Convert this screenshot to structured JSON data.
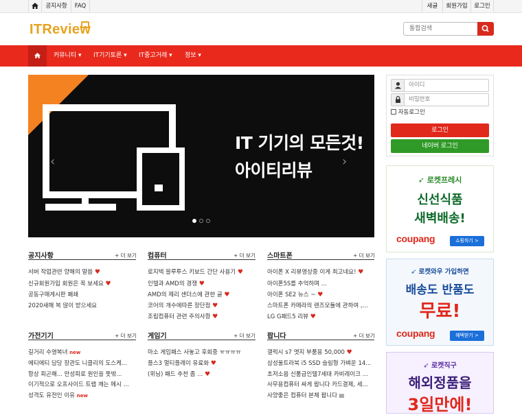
{
  "topbar": {
    "left": [
      "공지사항",
      "FAQ"
    ],
    "right": [
      "새글",
      "회원가입",
      "로그인"
    ]
  },
  "header": {
    "logo_text": "ITReview",
    "search_placeholder": "통합검색"
  },
  "nav": {
    "items": [
      "커뮤니티 ▾",
      "IT기기토론 ▾",
      "IT중고거래 ▾",
      "정보 ▾"
    ]
  },
  "slider": {
    "line1": "IT 기기의 모든것!",
    "line2": "아이티리뷰",
    "slide_count": 3,
    "active_slide": 1
  },
  "login": {
    "id_placeholder": "아이디",
    "pw_placeholder": "비밀번호",
    "remember_label": "자동로그인",
    "login_button": "로그인",
    "naver_button": "네이버 로그인"
  },
  "ads": [
    {
      "top": "로켓프레시",
      "line1": "신선식품",
      "line2": "새벽배송!",
      "brand": "coupang",
      "button": "쇼핑하기 >"
    },
    {
      "top": "로켓와우 가입하면",
      "line1": "배송도 반품도",
      "line2": "무료!",
      "brand": "coupang",
      "button": "혜택받기 >"
    },
    {
      "top": "로켓직구",
      "line1": "해외정품을",
      "line2": "3일만에!"
    }
  ],
  "boards": [
    {
      "title": "공지사항",
      "more": "+ 더 보기",
      "posts": [
        {
          "text": "서버 작업관련 양해의 말씀",
          "heart": true,
          "new": false
        },
        {
          "text": "신규회원가입 회원은 꼭 보세요",
          "heart": true,
          "new": false
        },
        {
          "text": "공동구매게시판 폐쇄",
          "heart": false,
          "new": false
        },
        {
          "text": "2020새해 복 많이 받으세요",
          "heart": false,
          "new": false
        }
      ]
    },
    {
      "title": "컴퓨터",
      "more": "+ 더 보기",
      "posts": [
        {
          "text": "로지텍 블루투스 키보드 간단 사용기",
          "heart": true,
          "new": false
        },
        {
          "text": "인텔과 AMD의 경쟁",
          "heart": true,
          "new": false
        },
        {
          "text": "AMD의 제리 샌더스에 관한 글",
          "heart": true,
          "new": false
        },
        {
          "text": "코어의 개수에따른 장단점",
          "heart": true,
          "new": false
        },
        {
          "text": "조립컴퓨터 관련 주의사항",
          "heart": true,
          "new": false
        }
      ]
    },
    {
      "title": "스마트폰",
      "more": "+ 더 보기",
      "posts": [
        {
          "text": "아이폰 X 리뷰영상중 이게 최고네요!",
          "heart": true,
          "new": false
        },
        {
          "text": "아이폰5S를 추억하며 ...",
          "heart": false,
          "new": false
        },
        {
          "text": "아이폰 SE2 뉴스 ~",
          "heart": true,
          "new": false
        },
        {
          "text": "스마트폰 카메라의 렌즈모듈에 관하여 ,...",
          "heart": false,
          "new": false
        },
        {
          "text": "LG G패드5 리뷰",
          "heart": true,
          "new": false
        }
      ]
    },
    {
      "title": "가전기기",
      "more": "+ 더 보기",
      "posts": [
        {
          "text": "길거리 수영복녀",
          "heart": false,
          "new": true
        },
        {
          "text": "에티에티 담당 장관도 니클리의 도스케...",
          "heart": false,
          "new": false
        },
        {
          "text": "항상 피곤해... 만성피로 원인을 뜻밖...",
          "heart": false,
          "new": false
        },
        {
          "text": "이기적으로 오프사이드 트랩 깨는 메시 ...",
          "heart": false,
          "new": false
        },
        {
          "text": "성격도 유전인 이유",
          "heart": false,
          "new": true
        }
      ]
    },
    {
      "title": "게임기",
      "more": "+ 더 보기",
      "posts": [
        {
          "text": "마소 게임패스 사놓고 후회중 ㅠㅠㅠㅠ",
          "heart": false,
          "new": false
        },
        {
          "text": "플스3 멀티플레이 유료화",
          "heart": true,
          "new": false
        },
        {
          "text": "(위닝) 패드 추천 좀 ...",
          "heart": true,
          "new": false
        }
      ]
    },
    {
      "title": "팝니다",
      "more": "+ 더 보기",
      "posts": [
        {
          "text": "갤럭시 s7 엣지 부품용 50,000",
          "heart": true,
          "new": false
        },
        {
          "text": "삼성울트라북 i5 SSD 슬림형 가벼운 14...",
          "heart": false,
          "new": false
        },
        {
          "text": "초저소음 신품급인텔7세대 카비레이크 ...",
          "heart": false,
          "new": false
        },
        {
          "text": "사무용컴퓨터 싸게 팝니다 카드결제, 세...",
          "heart": false,
          "new": false
        },
        {
          "text": "사양좋은 컴퓨터 본체 팝니다",
          "heart": false,
          "new": false
        }
      ]
    }
  ],
  "colors": {
    "brand_red": "#e8291c",
    "logo_orange": "#e8a21d",
    "naver_green": "#2f9a27",
    "coupang_blue": "#1a6fd9"
  }
}
